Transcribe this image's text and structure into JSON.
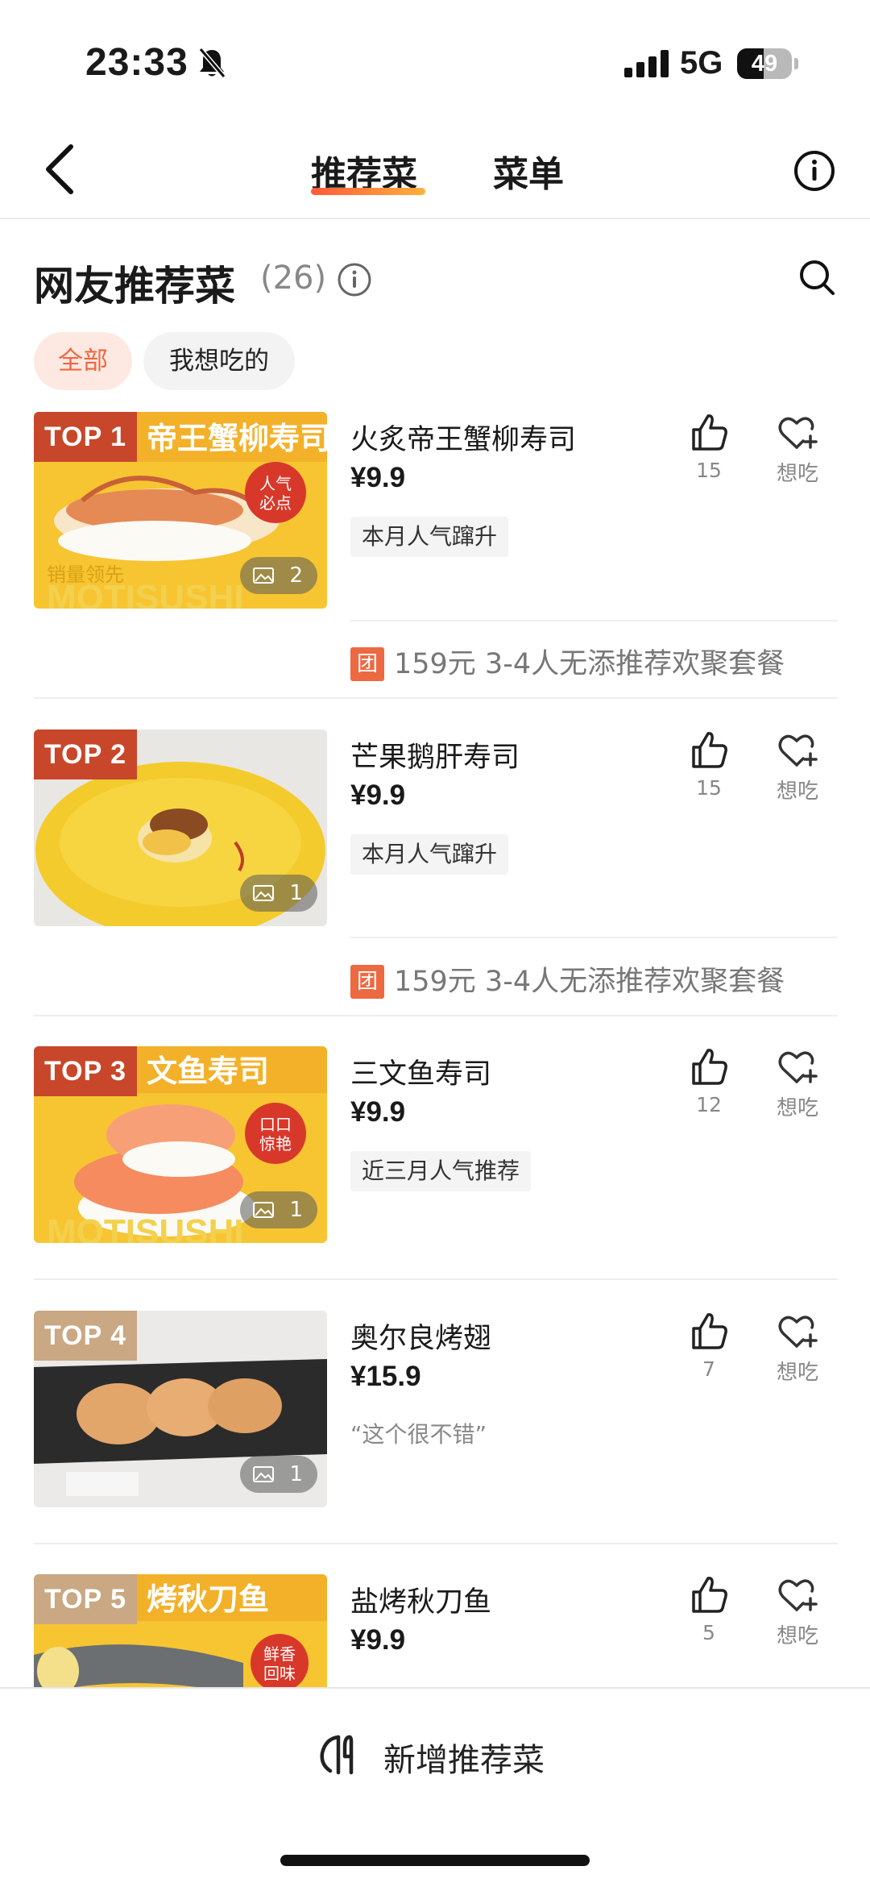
{
  "status_bar": {
    "time": "23:33",
    "network": "5G",
    "battery_level": 49,
    "battery_text": "49"
  },
  "nav": {
    "tabs": [
      {
        "label": "推荐菜"
      },
      {
        "label": "菜单"
      }
    ]
  },
  "section": {
    "title": "网友推荐菜",
    "count": "(26)",
    "filters": [
      {
        "label": "全部"
      },
      {
        "label": "我想吃的"
      }
    ]
  },
  "dishes": [
    {
      "rank": "TOP 1",
      "name": "火炙帝王蟹柳寿司",
      "price": "¥9.9",
      "tag": "本月人气蹿升",
      "likes": "15",
      "want_label": "想吃",
      "image_count": "2",
      "promo": {
        "badge": "团",
        "text": "159元 3-4人无添推荐欢聚套餐"
      }
    },
    {
      "rank": "TOP 2",
      "name": "芒果鹅肝寿司",
      "price": "¥9.9",
      "tag": "本月人气蹿升",
      "likes": "15",
      "want_label": "想吃",
      "image_count": "1",
      "promo": {
        "badge": "团",
        "text": "159元 3-4人无添推荐欢聚套餐"
      }
    },
    {
      "rank": "TOP 3",
      "name": "三文鱼寿司",
      "price": "¥9.9",
      "tag": "近三月人气推荐",
      "likes": "12",
      "want_label": "想吃",
      "image_count": "1"
    },
    {
      "rank": "TOP 4",
      "name": "奥尔良烤翅",
      "price": "¥15.9",
      "quote": "“这个很不错”",
      "likes": "7",
      "want_label": "想吃",
      "image_count": "1"
    },
    {
      "rank": "TOP 5",
      "name": "盐烤秋刀鱼",
      "price": "¥9.9",
      "likes": "5",
      "want_label": "想吃"
    }
  ],
  "image_texts": {
    "dish1_banner": "帝王蟹柳寿司",
    "dish1_seal": "人气必点",
    "dish1_footer": "销量领先",
    "dish1_logo": "MOTISUSHI",
    "dish3_banner": "文鱼寿司",
    "dish3_seal": "口口惊艳",
    "dish3_logo": "MOTISUSHI",
    "dish5_banner": "烤秋刀鱼",
    "dish5_seal": "鲜香回味"
  },
  "bottom": {
    "add_label": "新增推荐菜"
  },
  "colors": {
    "accent": "#f0683f",
    "badge_dark": "#c8472a",
    "badge_light": "#c9a883",
    "promo": "#ec6942"
  }
}
